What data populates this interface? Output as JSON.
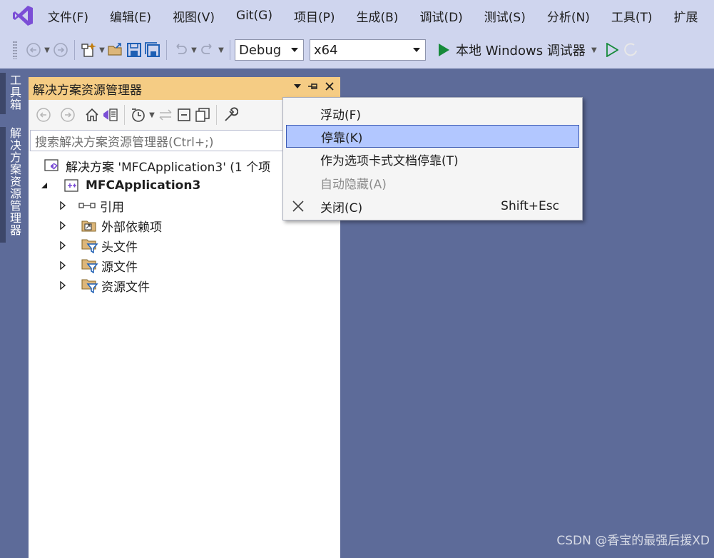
{
  "menubar": {
    "logo_icon": "visual-studio-logo-icon",
    "items": [
      {
        "label": "文件(F)"
      },
      {
        "label": "编辑(E)"
      },
      {
        "label": "视图(V)"
      },
      {
        "label": "Git(G)"
      },
      {
        "label": "项目(P)"
      },
      {
        "label": "生成(B)"
      },
      {
        "label": "调试(D)"
      },
      {
        "label": "测试(S)"
      },
      {
        "label": "分析(N)"
      },
      {
        "label": "工具(T)"
      },
      {
        "label": "扩展"
      }
    ]
  },
  "toolbar": {
    "configuration": "Debug",
    "platform": "x64",
    "run_label": "本地 Windows 调试器"
  },
  "side_tabs": {
    "toolbox": "工具箱",
    "solution_explorer": "解决方案资源管理器"
  },
  "solution_explorer": {
    "title": "解决方案资源管理器",
    "search_placeholder": "搜索解决方案资源管理器(Ctrl+;)",
    "tree": {
      "solution": "解决方案 'MFCApplication3' (1 个项",
      "project": "MFCApplication3",
      "children": [
        {
          "label": "引用",
          "icon": "references-icon"
        },
        {
          "label": "外部依赖项",
          "icon": "external-dependencies-icon"
        },
        {
          "label": "头文件",
          "icon": "filter-folder-icon"
        },
        {
          "label": "源文件",
          "icon": "filter-folder-icon"
        },
        {
          "label": "资源文件",
          "icon": "filter-folder-icon"
        }
      ]
    }
  },
  "context_menu": {
    "items": [
      {
        "label": "浮动(F)",
        "state": "normal"
      },
      {
        "label": "停靠(K)",
        "state": "highlighted"
      },
      {
        "label": "作为选项卡式文档停靠(T)",
        "state": "normal"
      },
      {
        "label": "自动隐藏(A)",
        "state": "disabled"
      },
      {
        "label": "关闭(C)",
        "shortcut": "Shift+Esc",
        "icon": "close-icon",
        "state": "normal"
      }
    ]
  },
  "colors": {
    "background": "#5d6b99",
    "chrome": "#cfd5ee",
    "panel_title": "#f5cc84",
    "highlight": "#b2c7ff"
  },
  "watermark": "CSDN @香宝的最强后援XD"
}
